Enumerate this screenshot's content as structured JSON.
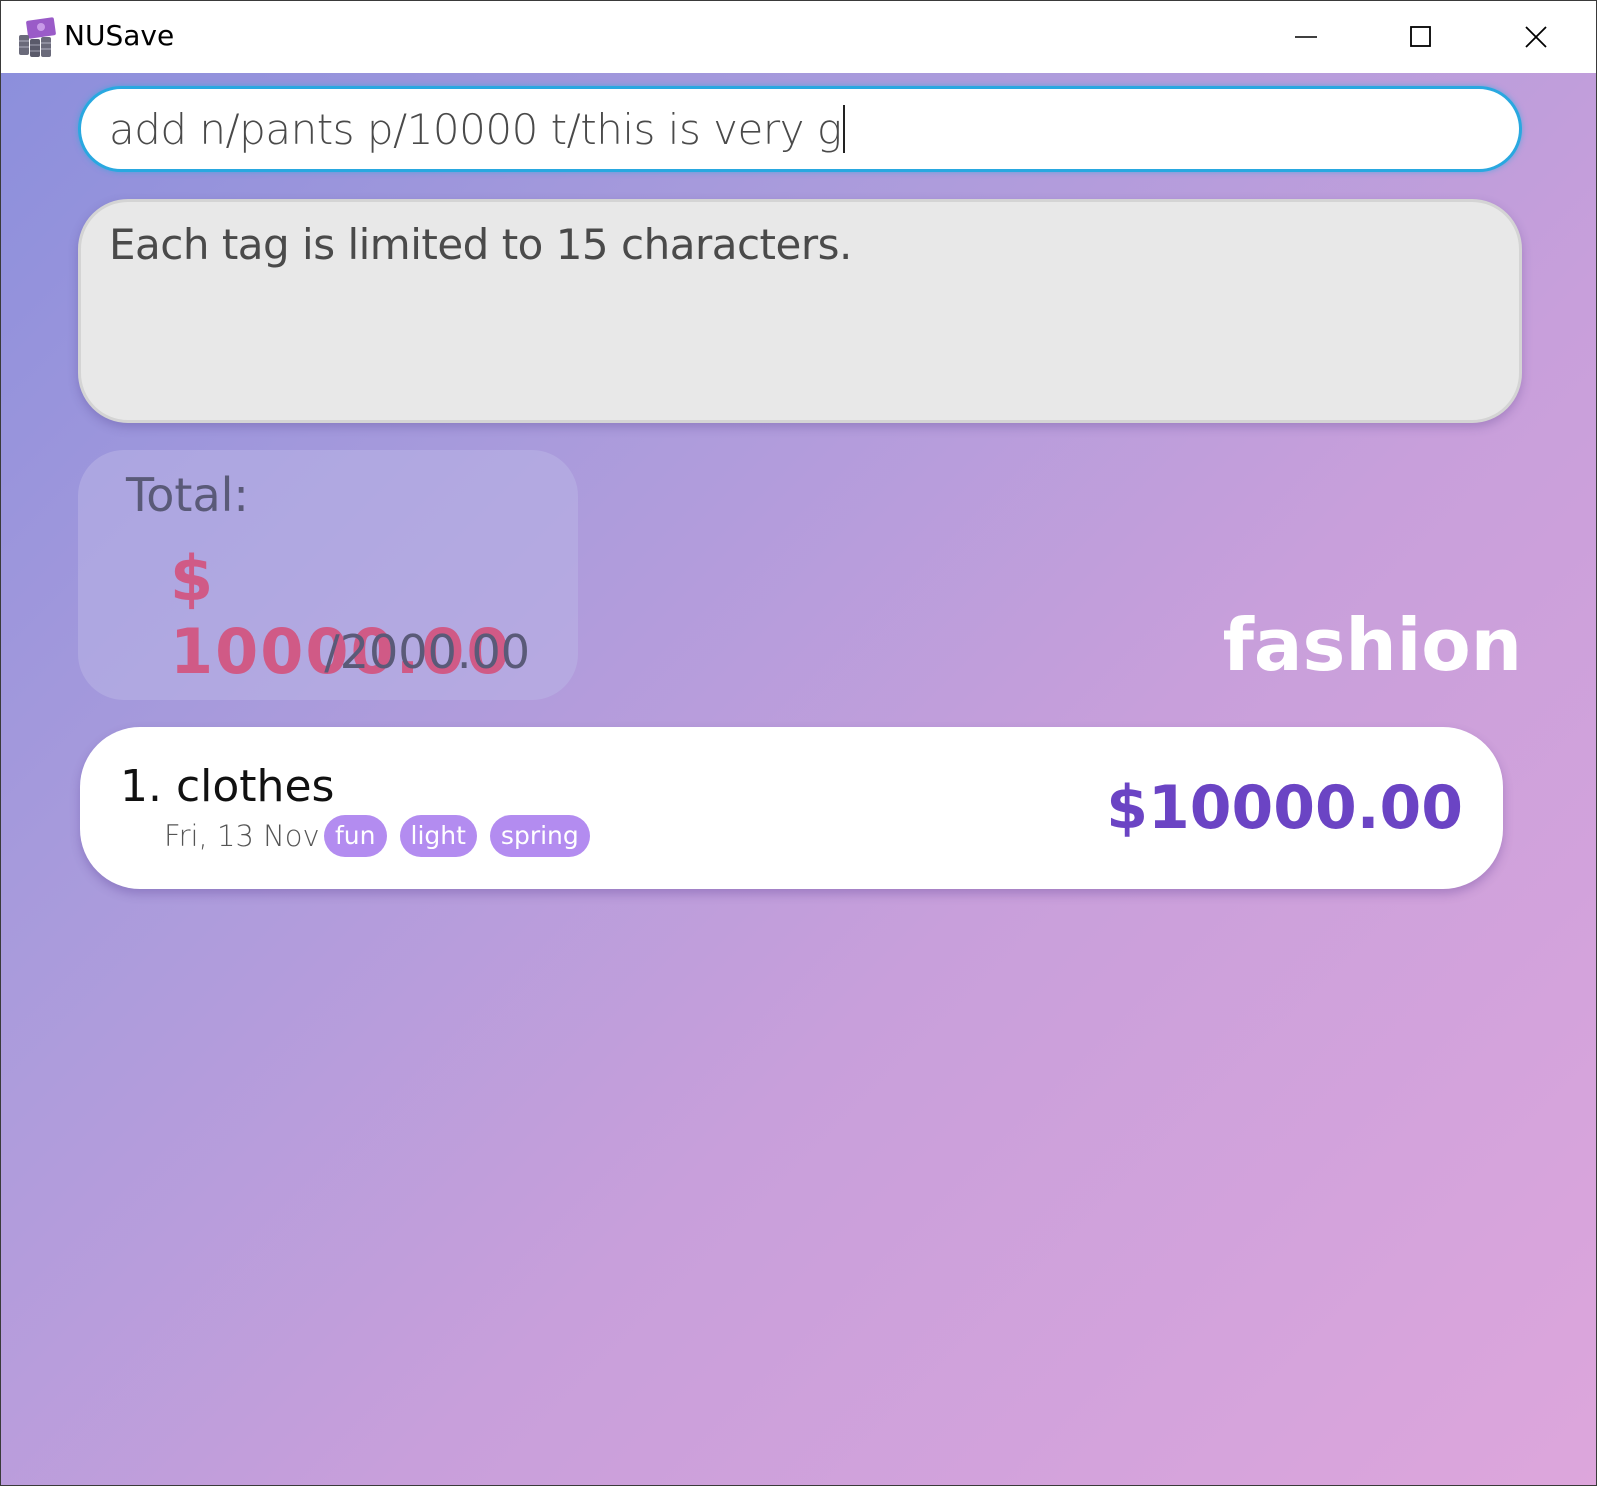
{
  "window": {
    "title": "NUSave",
    "icon": "money-coins-icon"
  },
  "command": {
    "value": "add n/pants p/10000 t/this is very g"
  },
  "result": {
    "message": "Each tag is limited to 15 characters."
  },
  "summary": {
    "label": "Total:",
    "amount": "$ 10000.00",
    "budget": "/2000.00"
  },
  "category": {
    "name": "fashion"
  },
  "expenses": [
    {
      "name": "1. clothes",
      "date": "Fri, 13 Nov",
      "tags": [
        "fun",
        "light",
        "spring"
      ],
      "price": "$10000.00"
    }
  ],
  "colors": {
    "accent": "#6b44c4",
    "tag": "#b38cf0",
    "over_budget": "#d05a86",
    "focus_border": "#29a8e0"
  }
}
